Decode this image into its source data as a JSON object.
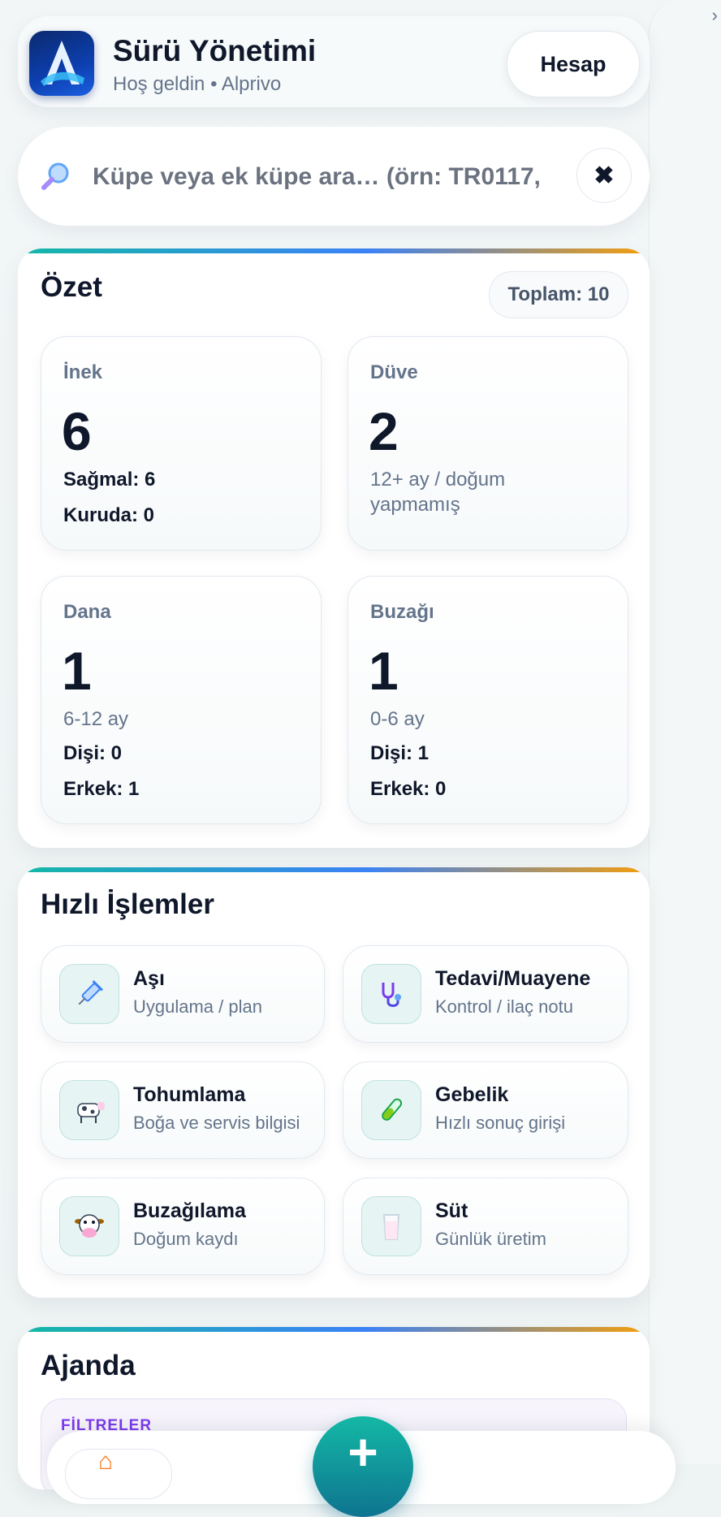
{
  "header": {
    "title": "Sürü Yönetimi",
    "subtitle": "Hoş geldin • Alprivo",
    "account_label": "Hesap",
    "logo_icon": "app-logo-a"
  },
  "search": {
    "placeholder": "Küpe veya ek küpe ara… (örn: TR0117,",
    "value": "",
    "clear_label": "✖",
    "icon": "magnifier-icon"
  },
  "summary": {
    "title": "Özet",
    "total_label": "Toplam: 10",
    "cards": [
      {
        "label": "İnek",
        "value": "6",
        "lines": [
          "Sağmal: 6",
          "Kuruda: 0"
        ]
      },
      {
        "label": "Düve",
        "value": "2",
        "note": "12+ ay / doğum yapmamış"
      },
      {
        "label": "Dana",
        "value": "1",
        "note": "6-12 ay",
        "lines": [
          "Dişi: 0",
          "Erkek: 1"
        ]
      },
      {
        "label": "Buzağı",
        "value": "1",
        "note": "0-6 ay",
        "lines": [
          "Dişi: 1",
          "Erkek: 0"
        ]
      }
    ]
  },
  "quick_actions": {
    "title": "Hızlı İşlemler",
    "items": [
      {
        "title": "Aşı",
        "subtitle": "Uygulama / plan",
        "icon": "syringe-icon"
      },
      {
        "title": "Tedavi/Muayene",
        "subtitle": "Kontrol / ilaç notu",
        "icon": "stethoscope-icon"
      },
      {
        "title": "Tohumlama",
        "subtitle": "Boğa ve servis bilgisi",
        "icon": "cow-icon"
      },
      {
        "title": "Gebelik",
        "subtitle": "Hızlı sonuç girişi",
        "icon": "test-tube-icon"
      },
      {
        "title": "Buzağılama",
        "subtitle": "Doğum kaydı",
        "icon": "cow-face-icon"
      },
      {
        "title": "Süt",
        "subtitle": "Günlük üretim",
        "icon": "milk-glass-icon"
      }
    ]
  },
  "agenda": {
    "title": "Ajanda",
    "filters_label": "FİLTRELER"
  },
  "bottom_nav": {
    "fab_label": "+",
    "home_icon": "home-icon"
  },
  "colors": {
    "accent_teal": "#14b8a6",
    "accent_blue": "#3b82f6",
    "accent_amber": "#f59e0b",
    "text_primary": "#0f172a",
    "text_muted": "#64748b"
  }
}
